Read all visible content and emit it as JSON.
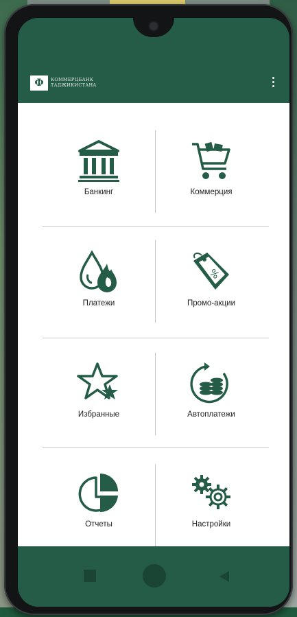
{
  "header": {
    "logo_glyph": "Ф",
    "bank_name_line1": "КОММЕРЦБАНК",
    "bank_name_line2": "ТАДЖИКИСТАНА"
  },
  "menu": [
    {
      "label": "Банкинг",
      "icon": "bank-icon"
    },
    {
      "label": "Коммерция",
      "icon": "cart-icon"
    },
    {
      "label": "Платежи",
      "icon": "utility-drops-icon"
    },
    {
      "label": "Промо-акции",
      "icon": "discount-tag-icon"
    },
    {
      "label": "Избранные",
      "icon": "star-icon"
    },
    {
      "label": "Автоплатежи",
      "icon": "coins-cycle-icon"
    },
    {
      "label": "Отчеты",
      "icon": "pie-chart-icon"
    },
    {
      "label": "Настройки",
      "icon": "gears-icon"
    }
  ],
  "colors": {
    "brand_green": "#245c47",
    "icon_green": "#245c47"
  }
}
